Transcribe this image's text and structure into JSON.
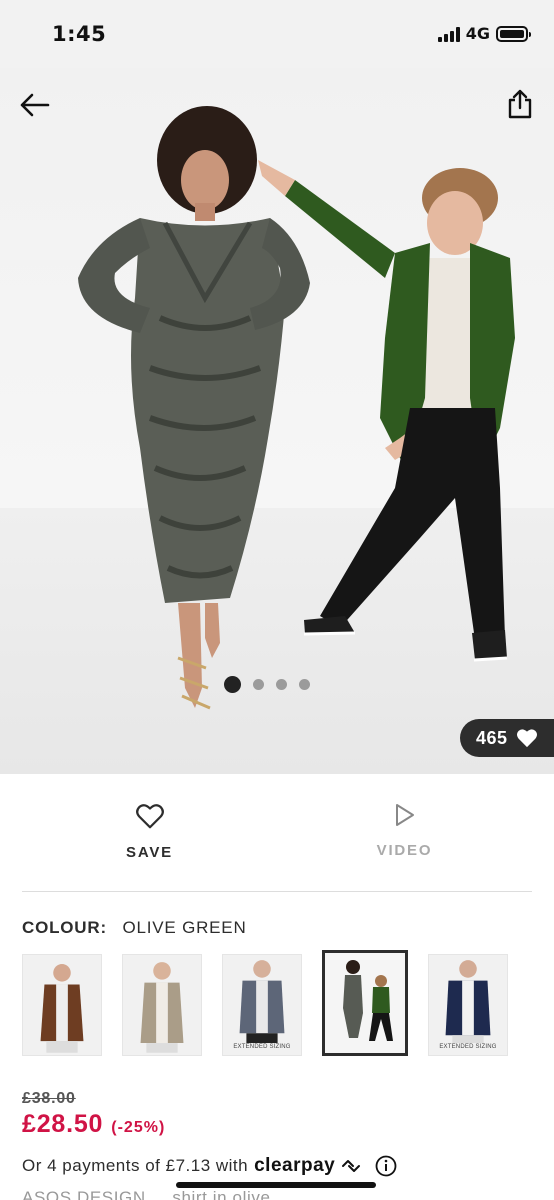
{
  "status_bar": {
    "time": "1:45",
    "network": "4G",
    "battery_level": 1.0
  },
  "hero": {
    "back_icon": "arrow-left-icon",
    "share_icon": "share-icon",
    "image_count": 4,
    "active_image": 1,
    "likes": "465",
    "likes_icon": "heart-filled-icon"
  },
  "actions": {
    "save_label": "SAVE",
    "save_icon": "heart-outline-icon",
    "video_label": "VIDEO",
    "video_icon": "play-outline-icon"
  },
  "colour": {
    "label": "COLOUR:",
    "value": "OLIVE GREEN",
    "swatches": [
      {
        "name": "brown-shirt",
        "selected": false,
        "tag": ""
      },
      {
        "name": "stone-shirt",
        "selected": false,
        "tag": ""
      },
      {
        "name": "grey-shirt",
        "selected": false,
        "tag": "EXTENDED SIZING"
      },
      {
        "name": "olive-green",
        "selected": true,
        "tag": ""
      },
      {
        "name": "navy-shirt",
        "selected": false,
        "tag": "EXTENDED SIZING"
      }
    ]
  },
  "price": {
    "original": "£38.00",
    "current": "£28.50",
    "discount": "(-25%)"
  },
  "installments": {
    "text": "Or 4 payments of £7.13 with",
    "brand": "clearpay",
    "info_icon": "info-icon"
  },
  "product": {
    "title": "ASOS DESIGN ... shirt in olive"
  },
  "colors": {
    "sale_red": "#d01345",
    "text_dark": "#2d2d2d",
    "muted": "#aaaaaa"
  }
}
